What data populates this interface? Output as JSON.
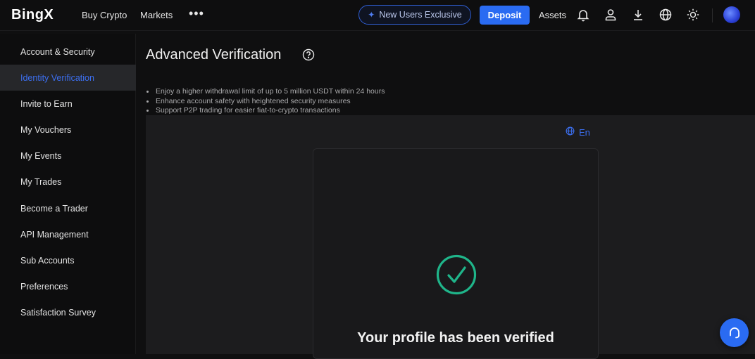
{
  "header": {
    "logo": "BingX",
    "nav": [
      "Buy Crypto",
      "Markets"
    ],
    "more": "•••",
    "promo_label": "New Users Exclusive",
    "deposit_label": "Deposit",
    "assets_label": "Assets",
    "icons": [
      "bell-icon",
      "user-icon",
      "download-icon",
      "globe-icon",
      "sun-icon"
    ]
  },
  "sidebar": {
    "items": [
      {
        "label": "Account & Security"
      },
      {
        "label": "Identity Verification"
      },
      {
        "label": "Invite to Earn"
      },
      {
        "label": "My Vouchers"
      },
      {
        "label": "My Events"
      },
      {
        "label": "My Trades"
      },
      {
        "label": "Become a Trader"
      },
      {
        "label": "API Management"
      },
      {
        "label": "Sub Accounts"
      },
      {
        "label": "Preferences"
      },
      {
        "label": "Satisfaction Survey"
      }
    ],
    "active": "Identity Verification"
  },
  "main": {
    "title": "Advanced Verification",
    "benefits": [
      "Enjoy a higher withdrawal limit of up to 5 million USDT within 24 hours",
      "Enhance account safety with heightened security measures",
      "Support P2P trading for easier fiat-to-crypto transactions"
    ],
    "language": "En",
    "status_text": "Your profile has been verified"
  },
  "colors": {
    "accent": "#2a6bf2",
    "active_text": "#3c6ff0",
    "success": "#1fb58a",
    "background": "#0f0f10",
    "panel": "#1c1c1e"
  }
}
